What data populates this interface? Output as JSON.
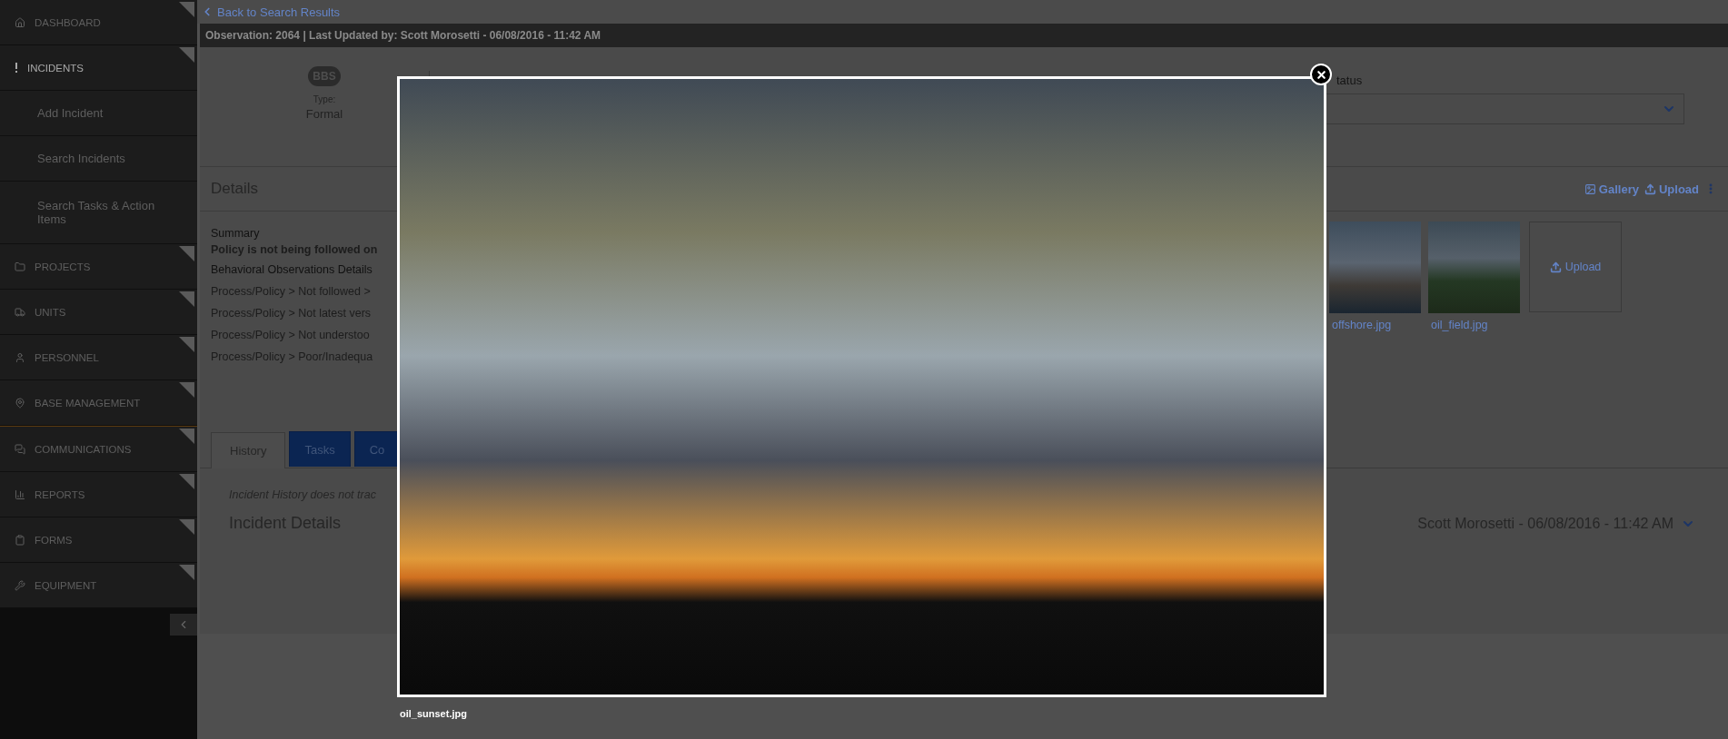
{
  "sidebar": {
    "items": [
      {
        "label": "DASHBOARD",
        "kind": "section",
        "selected": false
      },
      {
        "label": "INCIDENTS",
        "kind": "section",
        "selected": true
      },
      {
        "label": "Add Incident",
        "kind": "subitem",
        "selected": false
      },
      {
        "label": "Search Incidents",
        "kind": "subitem",
        "selected": false
      },
      {
        "label": "Search Tasks & Action Items",
        "kind": "subitem",
        "selected": false
      },
      {
        "label": "PROJECTS",
        "kind": "section",
        "selected": false
      },
      {
        "label": "UNITS",
        "kind": "section",
        "selected": false
      },
      {
        "label": "PERSONNEL",
        "kind": "section",
        "selected": false
      },
      {
        "label": "BASE MANAGEMENT",
        "kind": "section",
        "selected": false
      },
      {
        "label": "COMMUNICATIONS",
        "kind": "section",
        "selected": false
      },
      {
        "label": "REPORTS",
        "kind": "section",
        "selected": false
      },
      {
        "label": "FORMS",
        "kind": "section",
        "selected": false
      },
      {
        "label": "EQUIPMENT",
        "kind": "section",
        "selected": false
      }
    ]
  },
  "back_link": "Back to Search Results",
  "header": "Observation: 2064 | Last Updated by: Scott Morosetti - 06/08/2016 - 11:42 AM",
  "type_block": {
    "badge": "BBS",
    "label": "Type:",
    "value": "Formal"
  },
  "status": {
    "label": "tatus"
  },
  "details": {
    "title": "Details",
    "actions": [
      "Gallery",
      "Upload"
    ],
    "summary_label": "Summary",
    "summary": "Policy is not being followed on",
    "observations_label": "Behavioral Observations Details",
    "observations": [
      "Process/Policy > Not followed >",
      "Process/Policy > Not latest vers",
      "Process/Policy > Not understoo",
      "Process/Policy > Poor/Inadequa"
    ],
    "attachments": [
      {
        "name": "offshore.jpg"
      },
      {
        "name": "oil_field.jpg"
      }
    ],
    "upload_tile": "Upload"
  },
  "tabs": [
    {
      "label": "History",
      "selected": true
    },
    {
      "label": "Tasks",
      "selected": false
    },
    {
      "label": "Co",
      "selected": false
    }
  ],
  "history": {
    "note": "Incident History does not trac",
    "title": "Incident Details",
    "entry": "Scott Morosetti - 06/08/2016 - 11:42 AM"
  },
  "lightbox": {
    "caption": "oil_sunset.jpg"
  }
}
